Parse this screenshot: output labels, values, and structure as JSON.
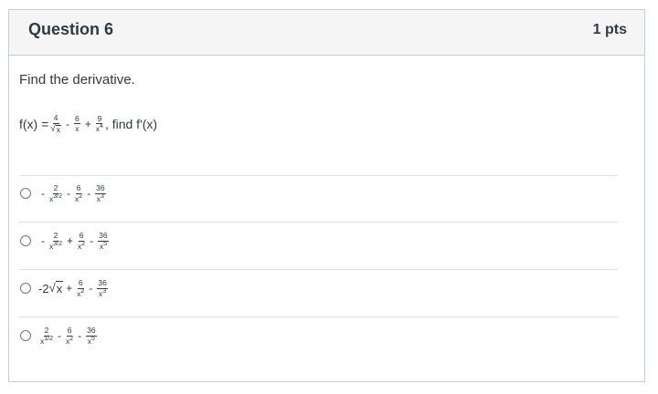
{
  "question": {
    "title": "Question 6",
    "points": "1 pts",
    "prompt": "Find the derivative."
  },
  "function": {
    "lhs": "f(x) =",
    "t1_num": "4",
    "t1_den_rad": "x",
    "op1": "-",
    "t2_num": "6",
    "t2_den": "x",
    "op2": "+",
    "t3_num": "9",
    "t3_den_base": "x",
    "t3_den_exp": "4",
    "tail": ", find f'(x)"
  },
  "answers": [
    {
      "lead": "-",
      "t1_num": "2",
      "t1_den_base": "x",
      "t1_den_exp": "3/2",
      "op1": "-",
      "t2_num": "6",
      "t2_den_base": "x",
      "t2_den_exp": "2",
      "op2": "-",
      "t3_num": "36",
      "t3_den_base": "x",
      "t3_den_exp": "3"
    },
    {
      "lead": "-",
      "t1_num": "2",
      "t1_den_base": "x",
      "t1_den_exp": "3/2",
      "op1": "+",
      "t2_num": "6",
      "t2_den_base": "x",
      "t2_den_exp": "2",
      "op2": "-",
      "t3_num": "36",
      "t3_den_base": "x",
      "t3_den_exp": "5"
    },
    {
      "lead": "-2",
      "rad": "x",
      "op1": "+",
      "t2_num": "6",
      "t2_den_base": "x",
      "t2_den_exp": "2",
      "op2": "-",
      "t3_num": "36",
      "t3_den_base": "x",
      "t3_den_exp": "3"
    },
    {
      "t1_num": "2",
      "t1_den_base": "x",
      "t1_den_exp": "1/2",
      "op1": "-",
      "t2_num": "6",
      "t2_den_base": "x",
      "t2_den_exp": "2",
      "op2": "-",
      "t3_num": "36",
      "t3_den_base": "x",
      "t3_den_exp": "5"
    }
  ]
}
